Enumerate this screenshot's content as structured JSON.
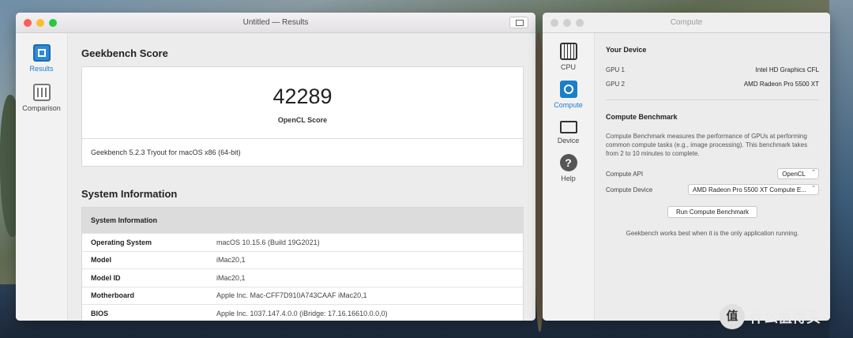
{
  "colors": {
    "accent": "#1b7ec9",
    "light_close": "#fc5f57",
    "light_min": "#fdbc2e",
    "light_max": "#28c840",
    "light_inactive": "#cfcfcf"
  },
  "results_window": {
    "title": "Untitled — Results",
    "sidebar": [
      {
        "label": "Results",
        "icon": "results-icon",
        "active": true
      },
      {
        "label": "Comparison",
        "icon": "comparison-icon",
        "active": false
      }
    ],
    "score_section_title": "Geekbench Score",
    "score": "42289",
    "score_label": "OpenCL Score",
    "version_note": "Geekbench 5.2.3 Tryout for macOS x86 (64-bit)",
    "sysinfo_section_title": "System Information",
    "sysinfo_table_header": "System Information",
    "sysinfo_rows": [
      {
        "key": "Operating System",
        "value": "macOS 10.15.6 (Build 19G2021)"
      },
      {
        "key": "Model",
        "value": "iMac20,1"
      },
      {
        "key": "Model ID",
        "value": "iMac20,1"
      },
      {
        "key": "Motherboard",
        "value": "Apple Inc. Mac-CFF7D910A743CAAF iMac20,1"
      },
      {
        "key": "BIOS",
        "value": "Apple Inc. 1037.147.4.0.0 (iBridge: 17.16.16610.0.0,0)"
      }
    ]
  },
  "compute_window": {
    "title": "Compute",
    "sidebar": [
      {
        "label": "CPU",
        "icon": "cpu-icon",
        "active": false
      },
      {
        "label": "Compute",
        "icon": "compute-icon",
        "active": true
      },
      {
        "label": "Device",
        "icon": "device-icon",
        "active": false
      },
      {
        "label": "Help",
        "icon": "help-icon",
        "active": false
      }
    ],
    "your_device_heading": "Your Device",
    "gpu1_label": "GPU 1",
    "gpu1_value": "Intel HD Graphics CFL",
    "gpu2_label": "GPU 2",
    "gpu2_value": "AMD Radeon Pro 5500 XT",
    "benchmark_heading": "Compute Benchmark",
    "benchmark_description": "Compute Benchmark measures the performance of GPUs at performing common compute tasks (e.g., image processing). This benchmark takes from 2 to 10 minutes to complete.",
    "compute_api_label": "Compute API",
    "compute_api_value": "OpenCL",
    "compute_device_label": "Compute Device",
    "compute_device_value": "AMD Radeon Pro 5500 XT Compute E...",
    "run_button": "Run Compute Benchmark",
    "note": "Geekbench works best when it is the only application running."
  },
  "watermark": {
    "logo_char": "值",
    "text": "什么值得买"
  }
}
